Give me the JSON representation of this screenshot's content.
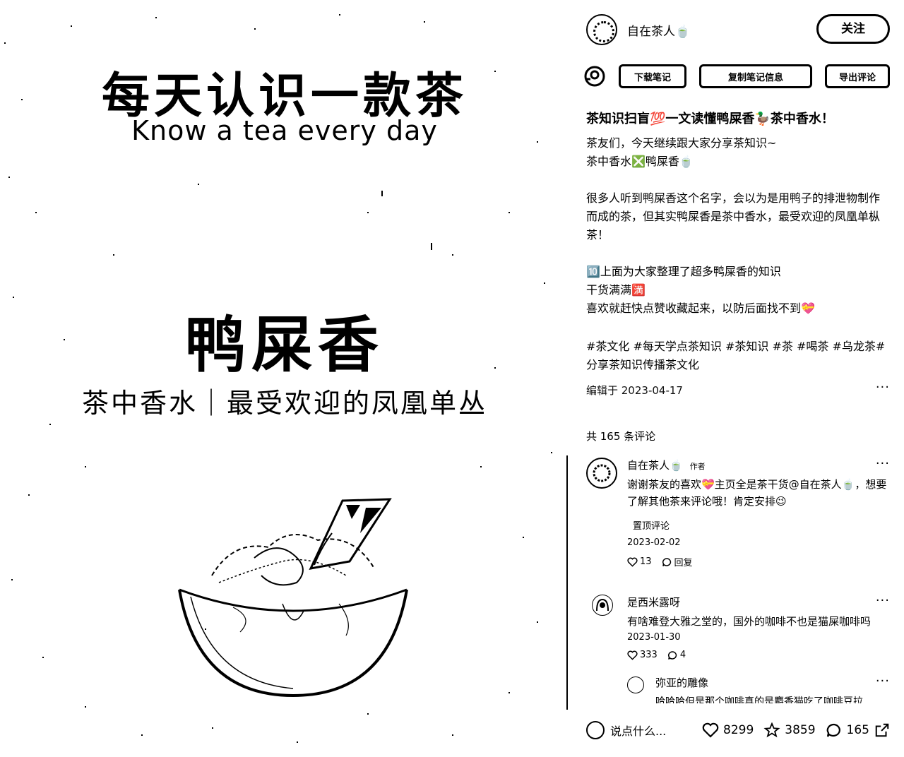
{
  "image_panel": {
    "title_cn": "每天认识一款茶",
    "title_en": "Know a tea every day",
    "tea_name": "鸭屎香",
    "subtitle": "茶中香水｜最受欢迎的凤凰单丛"
  },
  "author": {
    "name": "自在茶人🍵",
    "follow_label": "关注"
  },
  "toolbar": {
    "download_label": "下载笔记",
    "copy_label": "复制笔记信息",
    "export_label": "导出评论"
  },
  "post": {
    "title": "茶知识扫盲💯一文读懂鸭屎香🦆茶中香水！",
    "paragraphs": [
      "茶友们，今天继续跟大家分享茶知识~\n茶中香水❎鸭屎香🍵",
      "很多人听到鸭屎香这个名字，会以为是用鸭子的排泄物制作而成的茶，但其实鸭屎香是茶中香水，最受欢迎的凤凰单枞茶！",
      "🔟上面为大家整理了超多鸭屎香的知识\n干货满满🈵\n喜欢就赶快点赞收藏起来，以防后面找不到💝"
    ],
    "tags": "#茶文化 #每天学点茶知识 #茶知识 #茶 #喝茶 #乌龙茶#分享茶知识传播茶文化",
    "edited": "编辑于 2023-04-17",
    "more": "···"
  },
  "comments_header": "共 165 条评论",
  "comments": [
    {
      "name": "自在茶人🍵",
      "tag": "作者",
      "text": "谢谢茶友的喜欢💝主页全是茶干货@自在茶人🍵，想要了解其他茶来评论哦！肯定安排😉",
      "pinned": "置顶评论",
      "date": "2023-02-02",
      "likes": "13",
      "reply": "回复",
      "more": "···"
    },
    {
      "name": "是西米露呀",
      "text": "有啥难登大雅之堂的，国外的咖啡不也是猫屎咖啡吗",
      "date": "2023-01-30",
      "likes": "333",
      "replies": "4",
      "more": "···"
    },
    {
      "name": "弥亚的雕像",
      "text": "哈哈哈但是那个咖啡真的是麝香猫吃了咖啡豆拉",
      "more": "···"
    }
  ],
  "bottom_bar": {
    "comment_placeholder": "说点什么...",
    "likes": "8299",
    "collects": "3859",
    "comments": "165"
  }
}
